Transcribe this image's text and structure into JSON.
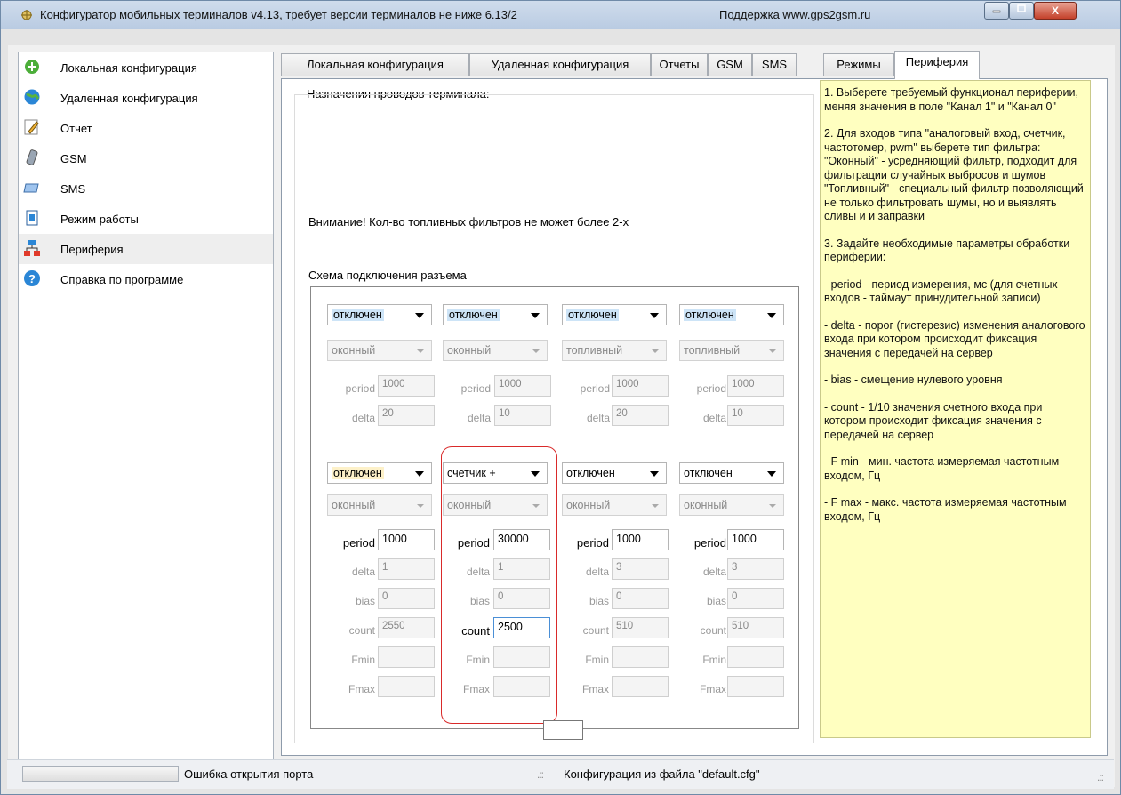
{
  "window": {
    "title": "Конфигуратор мобильных терминалов v4.13, требует версии терминалов не ниже 6.13/2",
    "support": "Поддержка www.gps2gsm.ru",
    "close_glyph": "X"
  },
  "sidebar": {
    "items": [
      {
        "label": "Локальная конфигурация",
        "icon": "local-config-icon"
      },
      {
        "label": "Удаленная конфигурация",
        "icon": "globe-icon"
      },
      {
        "label": "Отчет",
        "icon": "pencil-icon"
      },
      {
        "label": "GSM",
        "icon": "phone-icon"
      },
      {
        "label": "SMS",
        "icon": "sms-icon"
      },
      {
        "label": "Режим работы",
        "icon": "mode-icon"
      },
      {
        "label": "Периферия",
        "icon": "network-icon"
      },
      {
        "label": "Справка по программе",
        "icon": "help-icon"
      }
    ],
    "selected": "Периферия"
  },
  "tabs": [
    "Локальная конфигурация",
    "Удаленная конфигурация",
    "Отчеты",
    "GSM",
    "SMS",
    "Режимы",
    "Периферия"
  ],
  "active_tab": "Периферия",
  "panel": {
    "wires_title": "Назначения проводов терминала:",
    "warning": "Внимание! Кол-во топливных фильтров не может более 2-х",
    "scheme_title": "Схема подключения разъема"
  },
  "top_channels": [
    {
      "mode": "отключен",
      "filter": "оконный",
      "period": "1000",
      "delta": "20"
    },
    {
      "mode": "отключен",
      "filter": "оконный",
      "period": "1000",
      "delta": "10"
    },
    {
      "mode": "отключен",
      "filter": "топливный",
      "period": "1000",
      "delta": "20"
    },
    {
      "mode": "отключен",
      "filter": "топливный",
      "period": "1000",
      "delta": "10"
    }
  ],
  "bottom_channels": [
    {
      "mode": "отключен",
      "filter": "оконный",
      "period": "1000",
      "delta": "1",
      "bias": "0",
      "count": "2550",
      "fmin": "",
      "fmax": ""
    },
    {
      "mode": "счетчик +",
      "filter": "оконный",
      "period": "30000",
      "delta": "1",
      "bias": "0",
      "count": "2500",
      "fmin": "",
      "fmax": ""
    },
    {
      "mode": "отключен",
      "filter": "оконный",
      "period": "1000",
      "delta": "3",
      "bias": "0",
      "count": "510",
      "fmin": "",
      "fmax": ""
    },
    {
      "mode": "отключен",
      "filter": "оконный",
      "period": "1000",
      "delta": "3",
      "bias": "0",
      "count": "510",
      "fmin": "",
      "fmax": ""
    }
  ],
  "field_labels": {
    "period": "period",
    "delta": "delta",
    "bias": "bias",
    "count": "count",
    "fmin": "Fmin",
    "fmax": "Fmax"
  },
  "help_paragraphs": [
    "1. Выберете требуемый функционал периферии, меняя значения в поле \"Канал 1\" и \"Канал 0\"",
    "2. Для входов типа \"аналоговый вход, счетчик, частотомер, pwm\" выберете тип фильтра:\n\"Оконный\" - усредняющий фильтр, подходит для фильтрации случайных выбросов и шумов\n\"Топливный\" - специальный фильтр позволяющий не только фильтровать шумы, но и выявлять сливы и и заправки",
    "3. Задайте необходимые параметры обработки периферии:",
    " - period - период измерения, мс (для счетных входов - таймаут принудительной записи)",
    " - delta - порог (гистерезис) изменения аналогового входа при котором происходит фиксация значения с передачей на сервер",
    " - bias - смещение нулевого уровня",
    "- count - 1/10 значения счетного входа при котором происходит фиксация значения с передачей на сервер",
    "- F min - мин. частота измеряемая частотным входом, Гц",
    "- F max - макс. частота измеряемая частотным входом, Гц"
  ],
  "status": {
    "port_error": "Ошибка открытия порта",
    "config_file": "Конфигурация из файла \"default.cfg\""
  },
  "colors": {
    "help_bg": "#ffffc0",
    "highlight_blue": "#cde4f7",
    "highlight_yellow": "#fdf1c9",
    "annotation_red": "#d92a2a"
  }
}
